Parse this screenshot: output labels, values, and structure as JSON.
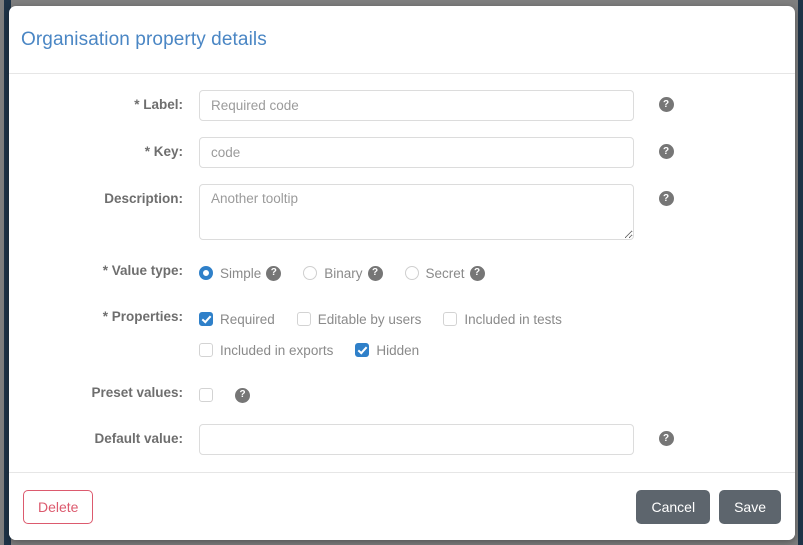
{
  "modal": {
    "title": "Organisation property details",
    "help_icon_glyph": "?",
    "help_icon_name": "help-icon"
  },
  "fields": {
    "label": {
      "label": "* Label:",
      "value": "",
      "placeholder": "Required code"
    },
    "key": {
      "label": "* Key:",
      "value": "",
      "placeholder": "code"
    },
    "description": {
      "label": "Description:",
      "value": "",
      "placeholder": "Another tooltip"
    },
    "value_type": {
      "label": "* Value type:",
      "options": [
        {
          "label": "Simple",
          "checked": true,
          "has_help": true
        },
        {
          "label": "Binary",
          "checked": false,
          "has_help": true
        },
        {
          "label": "Secret",
          "checked": false,
          "has_help": true
        }
      ]
    },
    "properties": {
      "label": "* Properties:",
      "row1": [
        {
          "label": "Required",
          "checked": true
        },
        {
          "label": "Editable by users",
          "checked": false
        },
        {
          "label": "Included in tests",
          "checked": false
        }
      ],
      "row2": [
        {
          "label": "Included in exports",
          "checked": false
        },
        {
          "label": "Hidden",
          "checked": true
        }
      ]
    },
    "preset_values": {
      "label": "Preset values:",
      "checked": false
    },
    "default_value": {
      "label": "Default value:",
      "value": "",
      "placeholder": ""
    }
  },
  "footer": {
    "delete_label": "Delete",
    "cancel_label": "Cancel",
    "save_label": "Save"
  },
  "colors": {
    "title_blue": "#4a86c4",
    "accent_blue": "#2f80c9",
    "danger_red": "#dc5a6e",
    "button_gray": "#5d656d",
    "label_gray": "#6e6e6e",
    "sidebar_navy": "#1f3448"
  }
}
